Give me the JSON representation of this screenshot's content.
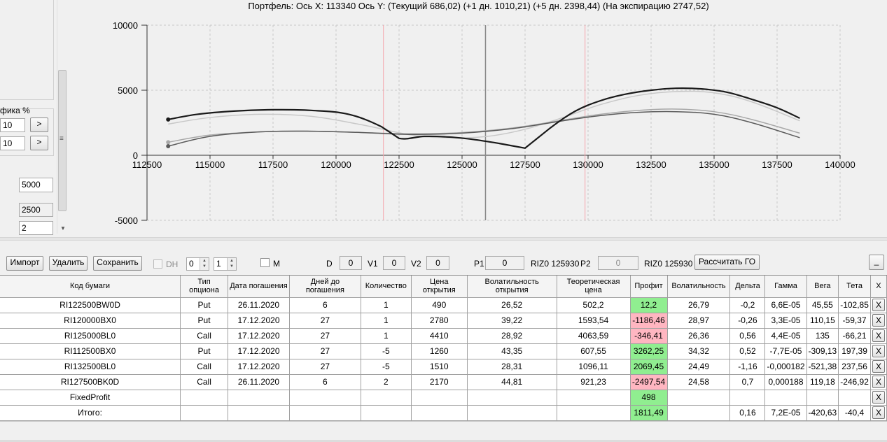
{
  "title": "Портфель: Ось X: 113340 Ось Y:  (Текущий 686,02)  (+1 дн. 1010,21)  (+5 дн. 2398,44)  (На экспирацию 2747,52)",
  "left_panel": {
    "chart_label": "фика %",
    "field1": "10",
    "field2": "10",
    "next_btn": ">",
    "val_5000": "5000",
    "val_2500": "2500",
    "val_2": "2",
    "scroll_grip": "≡"
  },
  "toolbar": {
    "import": "Импорт",
    "delete": "Удалить",
    "save": "Сохранить",
    "dh_label": "DH",
    "spin1": "0",
    "spin2": "1",
    "m_label": "M",
    "d_label": "D",
    "d_value": "0",
    "v1_label": "V1",
    "v1_value": "0",
    "v2_label": "V2",
    "v2_value": "0",
    "p1_label": "P1",
    "p1_value": "0",
    "p1_ticker": "RIZ0 125930",
    "p2_label": "P2",
    "p2_value": "0",
    "p2_ticker": "RIZ0 125930",
    "calc_go": "Рассчитать ГО",
    "minimize": "_"
  },
  "chart_data": {
    "type": "line",
    "title": "",
    "xlabel": "",
    "ylabel": "",
    "xlim": [
      112500,
      140000
    ],
    "ylim": [
      -5000,
      10000
    ],
    "x_ticks": [
      "112500",
      "115000",
      "117500",
      "120000",
      "122500",
      "125000",
      "127500",
      "130000",
      "132500",
      "135000",
      "137500",
      "140000"
    ],
    "y_ticks": [
      "10000",
      "5000",
      "0",
      "-5000"
    ],
    "grid": true,
    "vlines": [
      {
        "x": 121880,
        "color": "#f4a6ad"
      },
      {
        "x": 125930,
        "color": "#8a8a8a"
      },
      {
        "x": 129880,
        "color": "#f4a6ad"
      }
    ],
    "series": [
      {
        "color": "#1a1a1a",
        "width": 2.2,
        "x": [
          113340,
          114500,
          116000,
          117500,
          119000,
          120500,
          121800,
          122500,
          123500,
          124500,
          125500,
          126500,
          127500,
          128500,
          129500,
          130500,
          131500,
          132500,
          133500,
          134500,
          135500,
          136500,
          137500,
          138400
        ],
        "y": [
          2750,
          3150,
          3400,
          3500,
          3450,
          3150,
          2200,
          1300,
          1450,
          1400,
          1200,
          900,
          550,
          2100,
          3400,
          4200,
          4700,
          5000,
          5150,
          5100,
          4850,
          4300,
          3650,
          2850
        ]
      },
      {
        "color": "#c8c8c8",
        "width": 1.5,
        "x": [
          113340,
          115000,
          117000,
          119000,
          121000,
          123000,
          124500,
          126000,
          127500,
          129000,
          130500,
          132000,
          133500,
          135000,
          136500,
          138400
        ],
        "y": [
          2400,
          2900,
          3150,
          3000,
          2350,
          1550,
          1350,
          1450,
          2000,
          2900,
          3900,
          4600,
          4900,
          4800,
          4100,
          2650
        ]
      },
      {
        "color": "#a8a8a8",
        "width": 1.5,
        "x": [
          113340,
          115000,
          117000,
          119000,
          121000,
          123000,
          125000,
          127000,
          129000,
          130500,
          132000,
          133500,
          135000,
          136500,
          138400
        ],
        "y": [
          1000,
          1550,
          1800,
          1850,
          1750,
          1650,
          1750,
          2100,
          2700,
          3150,
          3450,
          3550,
          3350,
          2750,
          1700
        ]
      },
      {
        "color": "#5a5a5a",
        "width": 1.5,
        "x": [
          113340,
          115000,
          117000,
          119000,
          121000,
          123000,
          125000,
          127000,
          129000,
          130500,
          132000,
          133500,
          135000,
          136500,
          138400
        ],
        "y": [
          700,
          1450,
          1800,
          1850,
          1750,
          1600,
          1700,
          2050,
          2650,
          3050,
          3300,
          3350,
          3150,
          2500,
          1350
        ]
      }
    ],
    "start_markers": [
      {
        "x": 113340,
        "y": 2750,
        "color": "#1a1a1a"
      },
      {
        "x": 113340,
        "y": 1000,
        "color": "#a8a8a8"
      },
      {
        "x": 113340,
        "y": 700,
        "color": "#5a5a5a"
      }
    ]
  },
  "table": {
    "headers": [
      "Код бумаги",
      "Тип опциона",
      "Дата погашения",
      "Дней до погашения",
      "Количество",
      "Цена открытия",
      "Волатильность открытия",
      "Теоретическая цена",
      "Профит",
      "Волатильность",
      "Дельта",
      "Гамма",
      "Вега",
      "Тета",
      "X"
    ],
    "rows": [
      {
        "cells": [
          "RI122500BW0D",
          "Put",
          "26.11.2020",
          "6",
          "1",
          "490",
          "26,52",
          "502,2",
          "12,2",
          "26,79",
          "-0,2",
          "6,6E-05",
          "45,55",
          "-102,85"
        ],
        "profit_state": "pos"
      },
      {
        "cells": [
          "RI120000BX0",
          "Put",
          "17.12.2020",
          "27",
          "1",
          "2780",
          "39,22",
          "1593,54",
          "-1186,46",
          "28,97",
          "-0,26",
          "3,3E-05",
          "110,15",
          "-59,37"
        ],
        "profit_state": "neg"
      },
      {
        "cells": [
          "RI125000BL0",
          "Call",
          "17.12.2020",
          "27",
          "1",
          "4410",
          "28,92",
          "4063,59",
          "-346,41",
          "26,36",
          "0,56",
          "4,4E-05",
          "135",
          "-66,21"
        ],
        "profit_state": "neg"
      },
      {
        "cells": [
          "RI112500BX0",
          "Put",
          "17.12.2020",
          "27",
          "-5",
          "1260",
          "43,35",
          "607,55",
          "3262,25",
          "34,32",
          "0,52",
          "-7,7E-05",
          "-309,13",
          "197,39"
        ],
        "profit_state": "pos"
      },
      {
        "cells": [
          "RI132500BL0",
          "Call",
          "17.12.2020",
          "27",
          "-5",
          "1510",
          "28,31",
          "1096,11",
          "2069,45",
          "24,49",
          "-1,16",
          "-0,000182",
          "-521,38",
          "237,56"
        ],
        "profit_state": "pos"
      },
      {
        "cells": [
          "RI127500BK0D",
          "Call",
          "26.11.2020",
          "6",
          "2",
          "2170",
          "44,81",
          "921,23",
          "-2497,54",
          "24,58",
          "0,7",
          "0,000188",
          "119,18",
          "-246,92"
        ],
        "profit_state": "neg"
      },
      {
        "cells": [
          "FixedProfit",
          "",
          "",
          "",
          "",
          "",
          "",
          "",
          "498",
          "",
          "",
          "",
          "",
          ""
        ],
        "profit_state": "pos"
      },
      {
        "cells": [
          "Итого:",
          "",
          "",
          "",
          "",
          "",
          "",
          "",
          "1811,49",
          "",
          "0,16",
          "7,2E-05",
          "-420,63",
          "-40,4"
        ],
        "profit_state": "pos"
      }
    ],
    "delete_label": "X"
  }
}
